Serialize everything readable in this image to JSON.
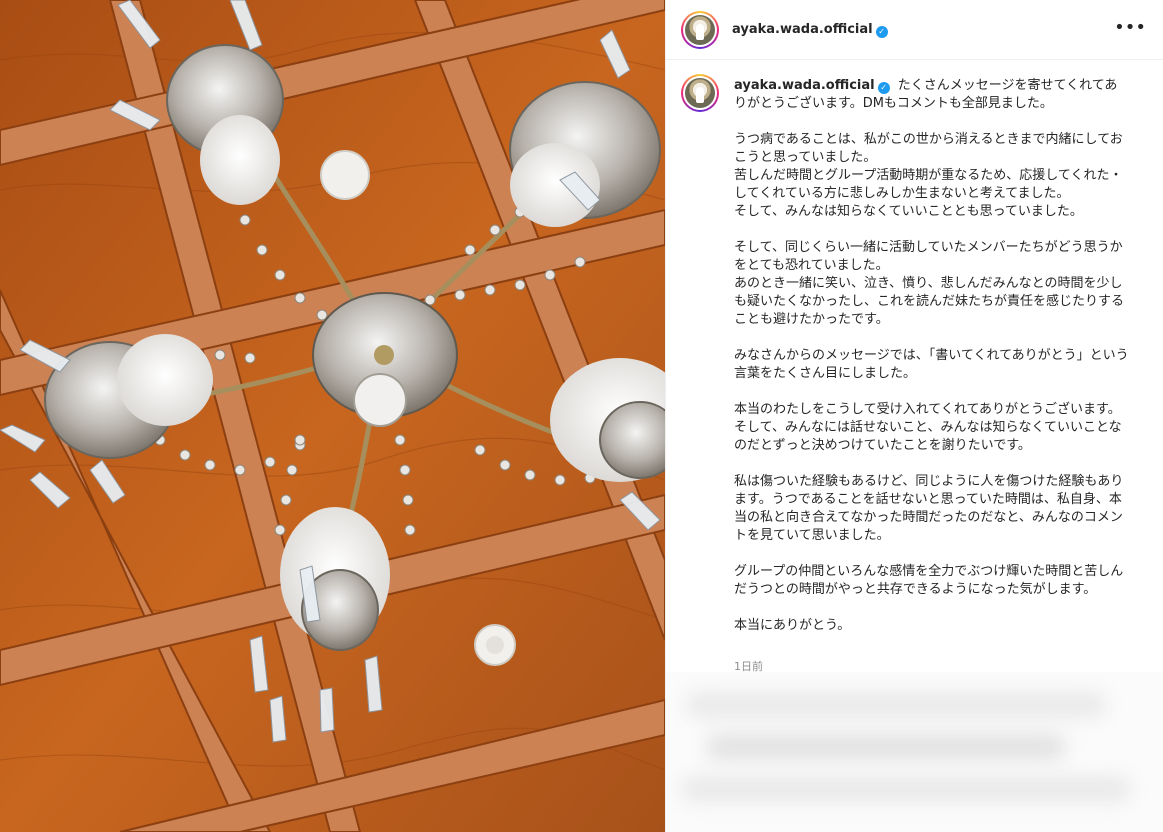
{
  "account": {
    "username": "ayaka.wada.official",
    "verified_icon": "verified-badge-icon"
  },
  "header": {
    "more_icon": "more-options-icon",
    "more_glyph": "•••"
  },
  "caption": {
    "lines": [
      [
        "たくさんメッセージを寄せてくれてありがとうございます。DMもコメントも全部見ました。"
      ],
      [
        "うつ病であることは、私がこの世から消えるときまで内緒にしておこうと思っていました。",
        "苦しんだ時間とグループ活動時期が重なるため、応援してくれた・してくれている方に悲しみしか生まないと考えてました。",
        "そして、みんなは知らなくていいこととも思っていました。"
      ],
      [
        "そして、同じくらい一緒に活動していたメンバーたちがどう思うかをとても恐れていました。",
        "あのとき一緒に笑い、泣き、憤り、悲しんだみんなとの時間を少しも疑いたくなかったし、これを読んだ妹たちが責任を感じたりすることも避けたかったです。"
      ],
      [
        "みなさんからのメッセージでは、「書いてくれてありがとう」という言葉をたくさん目にしました。"
      ],
      [
        "本当のわたしをこうして受け入れてくれてありがとうございます。そして、みんなには話せないこと、みんなは知らなくていいことなのだとずっと決めつけていたことを謝りたいです。"
      ],
      [
        "私は傷ついた経験もあるけど、同じように人を傷つけた経験もあります。うつであることを話せないと思っていた時間は、私自身、本当の私と向き合えてなかった時間だったのだなと、みんなのコメントを見ていて思いました。"
      ],
      [
        "グループの仲間といろんな感情を全力でぶつけ輝いた時間と苦しんだうつとの時間がやっと共存できるようになった気がします。"
      ],
      [
        "本当にありがとう。"
      ]
    ]
  },
  "timestamp": "1日前",
  "photo": {
    "description_icon": "chandelier-photo"
  },
  "colors": {
    "ceiling": "#b8581a",
    "beam": "#c97a4a",
    "verified": "#1d9bf0"
  }
}
